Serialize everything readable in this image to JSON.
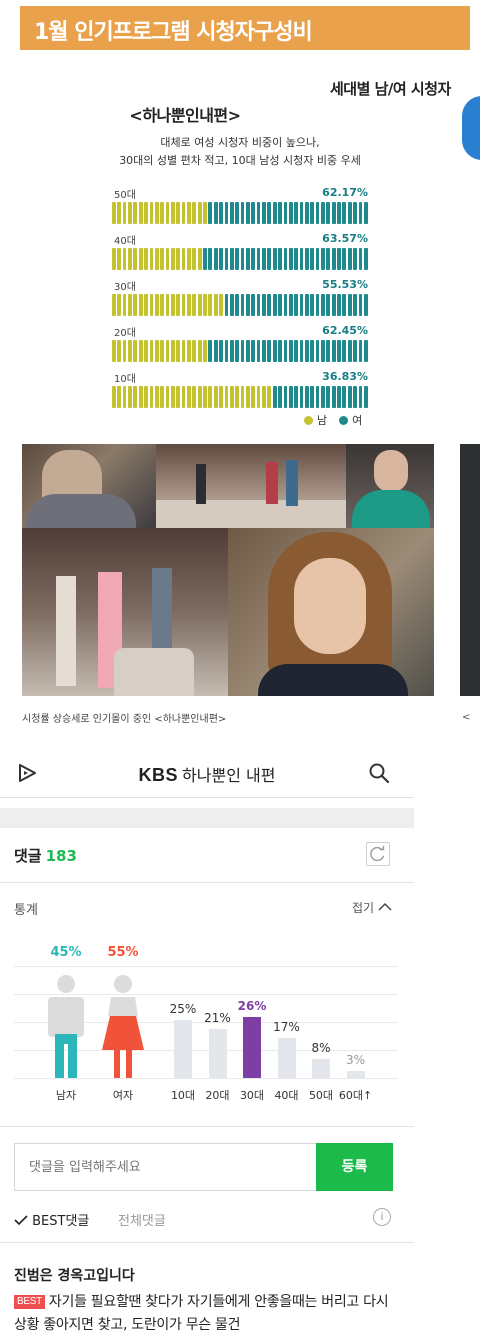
{
  "banner": {
    "title": "1월 인기프로그램 시청자구성비"
  },
  "infographic": {
    "side_title": "세대별 남/여 시청자",
    "title": "<하나뿐인내편>",
    "subtitle_lines": [
      "대체로 여성 시청자 비중이 높으나,",
      "30대의 성별 편차 적고, 10대 남성 시청자 비중 우세"
    ],
    "legend": {
      "male": "남",
      "female": "여"
    },
    "colors": {
      "male": "#c4c22f",
      "female": "#1e8a8d"
    }
  },
  "chart_data": {
    "type": "bar",
    "title": "<하나뿐인내편>",
    "categories": [
      "50대",
      "40대",
      "30대",
      "20대",
      "10대"
    ],
    "series": [
      {
        "name": "여",
        "values": [
          62.17,
          63.57,
          55.53,
          62.45,
          36.83
        ]
      }
    ],
    "value_labels": [
      "62.17%",
      "63.57%",
      "55.53%",
      "62.45%",
      "36.83%"
    ],
    "ylim": [
      0,
      100
    ],
    "legend_position": "bottom-right"
  },
  "photos": {
    "caption": "시청률 상승세로 인기몰이 중인 <하나뿐인내편>",
    "edge_caption": "<"
  },
  "kbs": {
    "brand": "KBS",
    "title": "하나뿐인 내편"
  },
  "comments": {
    "label": "댓글",
    "count": "183",
    "stats_label": "통계",
    "fold_label": "접기",
    "gender": [
      {
        "label": "남자",
        "pct": "45%",
        "color": "#2bb7b9"
      },
      {
        "label": "여자",
        "pct": "55%",
        "color": "#f0533a"
      }
    ],
    "ages": [
      {
        "label": "10대",
        "pct": "25%",
        "value": 25
      },
      {
        "label": "20대",
        "pct": "21%",
        "value": 21
      },
      {
        "label": "30대",
        "pct": "26%",
        "value": 26
      },
      {
        "label": "40대",
        "pct": "17%",
        "value": 17
      },
      {
        "label": "50대",
        "pct": "8%",
        "value": 8
      },
      {
        "label": "60대↑",
        "pct": "3%",
        "value": 3
      }
    ],
    "highlight_color": "#7d3fa3",
    "input_placeholder": "댓글을 입력해주세요",
    "submit_label": "등록",
    "tab_best": "BEST댓글",
    "tab_all": "전체댓글",
    "info": "i",
    "first_comment": {
      "author": "진범은 경옥고입니다",
      "badge": "BEST",
      "text": "자기들 필요할땐 찾다가 자기들에게 안좋을때는 버리고 다시 상황 좋아지면 찾고, 도란이가 무슨 물건"
    }
  }
}
